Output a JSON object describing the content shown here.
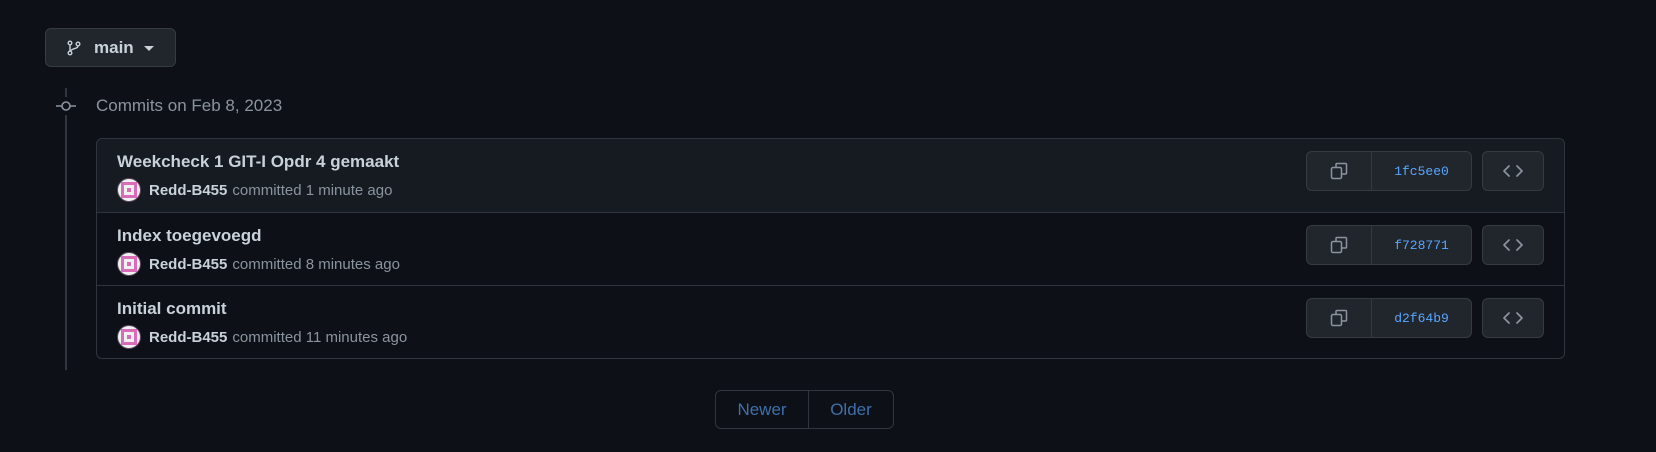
{
  "branch": {
    "name": "main"
  },
  "commit_group": {
    "title": "Commits on Feb 8, 2023"
  },
  "commits": [
    {
      "message": "Weekcheck 1 GIT-I Opdr 4 gemaakt",
      "author": "Redd-B455",
      "action": "committed",
      "time": "1 minute ago",
      "sha": "1fc5ee0"
    },
    {
      "message": "Index toegevoegd",
      "author": "Redd-B455",
      "action": "committed",
      "time": "8 minutes ago",
      "sha": "f728771"
    },
    {
      "message": "Initial commit",
      "author": "Redd-B455",
      "action": "committed",
      "time": "11 minutes ago",
      "sha": "d2f64b9"
    }
  ],
  "pagination": {
    "newer": "Newer",
    "older": "Older"
  },
  "colors": {
    "background": "#0d1117",
    "link": "#58a6ff",
    "muted": "#8b949e",
    "text": "#c9d1d9"
  },
  "icons": {
    "branch": "git-branch-icon",
    "copy": "copy-icon",
    "code": "code-icon",
    "commit": "git-commit-icon"
  }
}
